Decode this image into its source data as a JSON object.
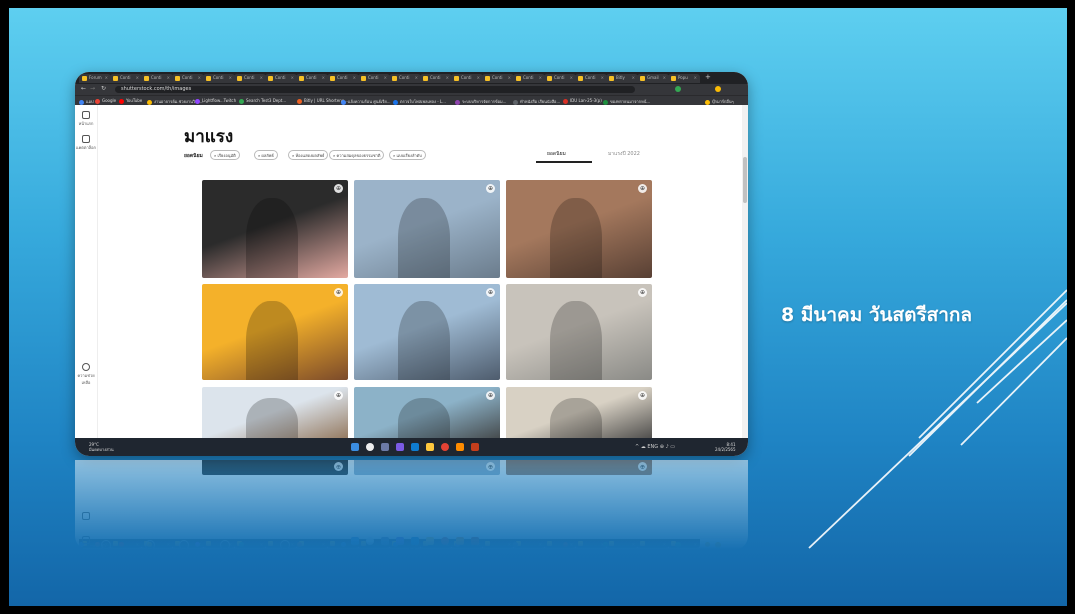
{
  "slide": {
    "title": "8 มีนาคม วันสตรีสากล",
    "background_colors": [
      "#5ecff0",
      "#1f84c4",
      "#1366a8"
    ]
  },
  "browser": {
    "tabs": [
      {
        "label": "Forum"
      },
      {
        "label": "Conti"
      },
      {
        "label": "Conti"
      },
      {
        "label": "Conti"
      },
      {
        "label": "Conti"
      },
      {
        "label": "Conti"
      },
      {
        "label": "Conti"
      },
      {
        "label": "Conti"
      },
      {
        "label": "Conti"
      },
      {
        "label": "Conti"
      },
      {
        "label": "Conti"
      },
      {
        "label": "Conti"
      },
      {
        "label": "Conti"
      },
      {
        "label": "Conti"
      },
      {
        "label": "Conti"
      },
      {
        "label": "Conti"
      },
      {
        "label": "Conti"
      },
      {
        "label": "Bitly"
      },
      {
        "label": "Gmail"
      },
      {
        "label": "Popu"
      }
    ],
    "url": "shutterstock.com/th/images",
    "bookmarks": [
      {
        "label": "แอป",
        "color": "#4285f4"
      },
      {
        "label": "Google",
        "color": "#ea4335"
      },
      {
        "label": "YouTube",
        "color": "#ff0000"
      },
      {
        "label": "งานอาจารย์ม.ช่วยงานวิจัย...",
        "color": "#fbbc05"
      },
      {
        "label": "Lightflow...Twitch",
        "color": "#9146ff"
      },
      {
        "label": "Search Test3 Dept...",
        "color": "#34a853"
      },
      {
        "label": "Bitly | URL Shortene...",
        "color": "#ee6123"
      },
      {
        "label": "แจ้งความร้อน ศูนย์เรีย...",
        "color": "#4285f4"
      },
      {
        "label": "ตรวจใบโพสเพลเพลง - L...",
        "color": "#1a73e8"
      },
      {
        "label": "ระบบบริหารจัดการข้อม...",
        "color": "#8e44ad"
      },
      {
        "label": "ทำหนังสือ เรียนนังสือ...",
        "color": "#5f6368"
      },
      {
        "label": "IDU Lan-25-3(p)",
        "color": "#d93025"
      },
      {
        "label": "ของทรายนมาจากหน้...",
        "color": "#1e8e3e"
      },
      {
        "label": "บุ๊กมาร์กอื่นๆ",
        "color": "#fbbc05"
      }
    ]
  },
  "sidebar": {
    "items": [
      {
        "label": "หน้าแรก",
        "icon": "home-icon"
      },
      {
        "label": "แคตตาล็อก",
        "icon": "catalog-icon"
      }
    ],
    "help_label": "ความช่วยเหลือ"
  },
  "main": {
    "title": "มาแรง",
    "filter_label": "ยอดนิยม",
    "chips": [
      "เรียงอนุมัติ",
      "ผลลัพธ์",
      "ห้องแสดงผลลัพธ์",
      "ความสมดุลของธรรมชาติ",
      "แบบเรียงลำดับ"
    ],
    "tabs": [
      "ยอดนิยม",
      "มาแรงปี 2022"
    ],
    "active_tab": 0
  },
  "photos": [
    {
      "subject": "Smiling woman with curly hair, pink top",
      "colors": [
        "#2b2b2b",
        "#e3a9a1"
      ]
    },
    {
      "subject": "Two senior women laughing outdoors",
      "colors": [
        "#9bb3c9",
        "#6b7c8c"
      ]
    },
    {
      "subject": "Group of friends laughing on steps",
      "colors": [
        "#a4785d",
        "#584034"
      ]
    },
    {
      "subject": "Laughing woman on yellow background",
      "colors": [
        "#f4b12a",
        "#7b4a2a"
      ]
    },
    {
      "subject": "Woman jumping on pier at sunset",
      "colors": [
        "#9fbbd4",
        "#4e5c6d"
      ]
    },
    {
      "subject": "Woman painting at a table",
      "colors": [
        "#c8c3bb",
        "#8a8a86"
      ]
    },
    {
      "subject": "Woman with flowing hair",
      "colors": [
        "#dce4ec",
        "#8a6a4c"
      ]
    },
    {
      "subject": "Women in beanies by the water",
      "colors": [
        "#8cb2c8",
        "#3b3b3a"
      ]
    },
    {
      "subject": "Runner on concrete wall",
      "colors": [
        "#d8d1c4",
        "#3a3a3a"
      ]
    }
  ],
  "taskbar": {
    "weather": [
      "29°C",
      "มีแดดบางส่วน"
    ],
    "clock": [
      "8:41",
      "24/2/2565"
    ],
    "tray": "^ ☁ ENG ⊕ ♪ ▭"
  }
}
